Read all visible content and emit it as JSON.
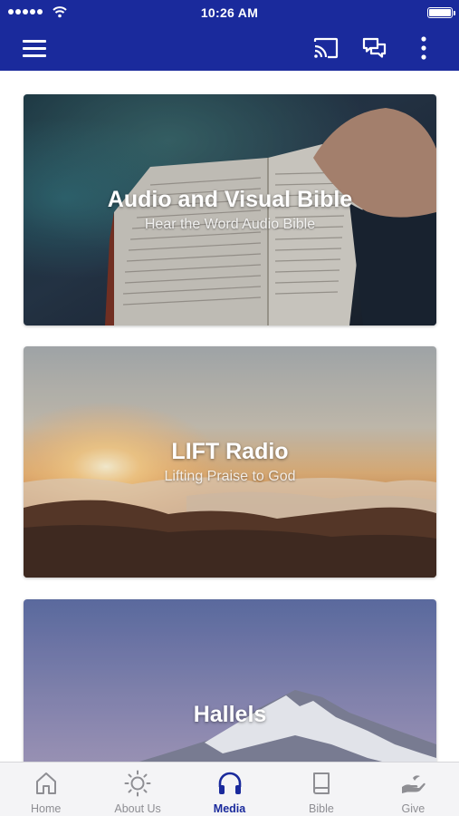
{
  "status_bar": {
    "time": "10:26 AM",
    "signal_icon": "signal-dots-icon",
    "wifi_icon": "wifi-icon",
    "battery_icon": "battery-icon"
  },
  "app_bar": {
    "menu_icon": "hamburger-menu-icon",
    "actions": [
      "cast-icon",
      "chat-icon",
      "more-vert-icon"
    ]
  },
  "cards": [
    {
      "title": "Audio and Visual Bible",
      "subtitle": "Hear the Word Audio Bible"
    },
    {
      "title": "LIFT Radio",
      "subtitle": "Lifting Praise to God"
    },
    {
      "title": "Hallels",
      "subtitle": ""
    }
  ],
  "tab_bar": {
    "tabs": [
      {
        "label": "Home",
        "icon": "home-icon"
      },
      {
        "label": "About Us",
        "icon": "sun-icon"
      },
      {
        "label": "Media",
        "icon": "headphones-icon"
      },
      {
        "label": "Bible",
        "icon": "book-icon"
      },
      {
        "label": "Give",
        "icon": "hand-icon"
      }
    ],
    "active": "Media"
  },
  "colors": {
    "primary": "#1a2a9c",
    "tab_inactive": "#8e8e93",
    "tab_background": "#f4f4f6"
  }
}
